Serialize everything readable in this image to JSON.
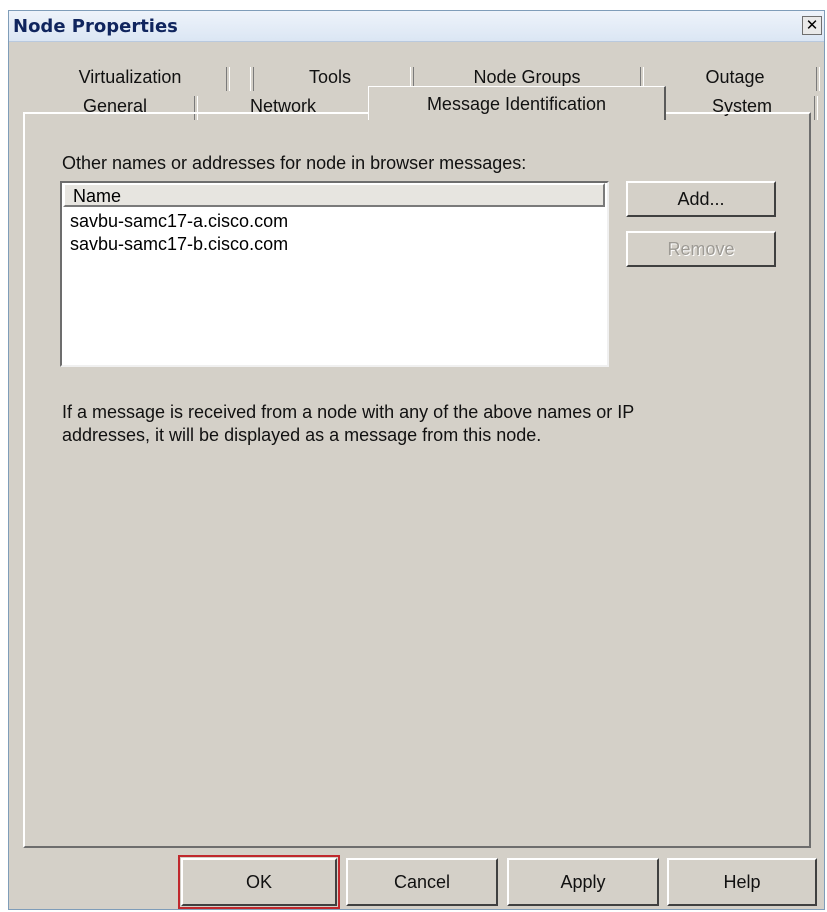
{
  "window": {
    "title": "Node Properties",
    "close_glyph": "✕"
  },
  "tabs": {
    "row_back": [
      "Virtualization",
      "Tools",
      "Node Groups",
      "Outage"
    ],
    "row_front": [
      "General",
      "Network",
      "Message Identification",
      "System"
    ],
    "active": "Message Identification"
  },
  "panel": {
    "list_label": "Other names or addresses for node in browser messages:",
    "column_header": "Name",
    "entries": [
      "savbu-samc17-a.cisco.com",
      "savbu-samc17-b.cisco.com"
    ],
    "add_button": "Add...",
    "remove_button": "Remove",
    "info_line1": "If a message is received from a node with any of the above names or IP",
    "info_line2": "addresses, it will be displayed as a message from this node."
  },
  "footer": {
    "ok": "OK",
    "cancel": "Cancel",
    "apply": "Apply",
    "help": "Help",
    "highlight_color": "#c0282d"
  }
}
